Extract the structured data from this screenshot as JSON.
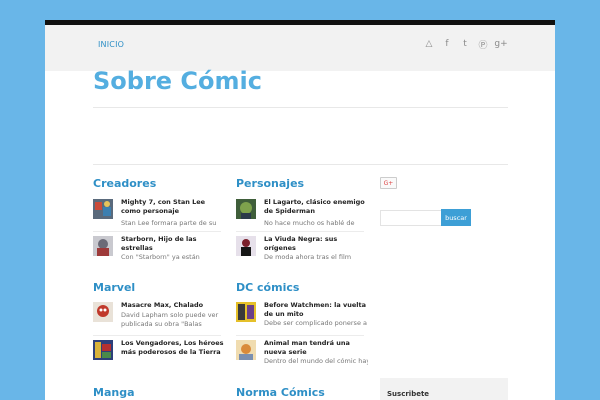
{
  "nav": {
    "home_label": "INICIO",
    "social_icons": [
      "rss-icon",
      "facebook-icon",
      "twitter-icon",
      "pinterest-icon",
      "google-plus-icon"
    ],
    "social_glyphs": [
      "△",
      "f",
      "t",
      "Ⓟ",
      "g+"
    ]
  },
  "site": {
    "title": "Sobre Cómic"
  },
  "categories": [
    {
      "title": "Creadores",
      "items": [
        {
          "title": "Mighty 7, con Stan Lee como personaje",
          "excerpt": "Stan Lee formara parte de su"
        },
        {
          "title": "Starborn, Hijo de las estrellas",
          "excerpt": "Con \"Starborn\" ya están"
        }
      ]
    },
    {
      "title": "Personajes",
      "items": [
        {
          "title": "El Lagarto, clásico enemigo de Spiderman",
          "excerpt": "No hace mucho os hablé de"
        },
        {
          "title": "La Viuda Negra: sus orígenes",
          "excerpt": "De moda ahora tras el film"
        }
      ]
    },
    {
      "title": "Marvel",
      "items": [
        {
          "title": "Masacre Max, Chalado",
          "excerpt": "David Lapham solo puede ver publicada su obra \"Balas"
        },
        {
          "title": "Los Vengadores, Los héroes más poderosos de la Tierra",
          "excerpt": ""
        }
      ]
    },
    {
      "title": "DC cómics",
      "items": [
        {
          "title": "Before Watchmen: la vuelta de un mito",
          "excerpt": "Debe ser complicado ponerse a"
        },
        {
          "title": "Animal man tendrá una nueva serie",
          "excerpt": "Dentro del mundo del cómic hay"
        }
      ]
    },
    {
      "title": "Manga",
      "items": []
    },
    {
      "title": "Norma Cómics",
      "items": []
    }
  ],
  "sidebar": {
    "gplus_label": "G+",
    "search_button": "buscar",
    "search_placeholder": "",
    "subscribe_title": "Suscribete"
  },
  "colors": {
    "background": "#69b6e8",
    "accent": "#2e8fc6",
    "title": "#54aee0"
  }
}
